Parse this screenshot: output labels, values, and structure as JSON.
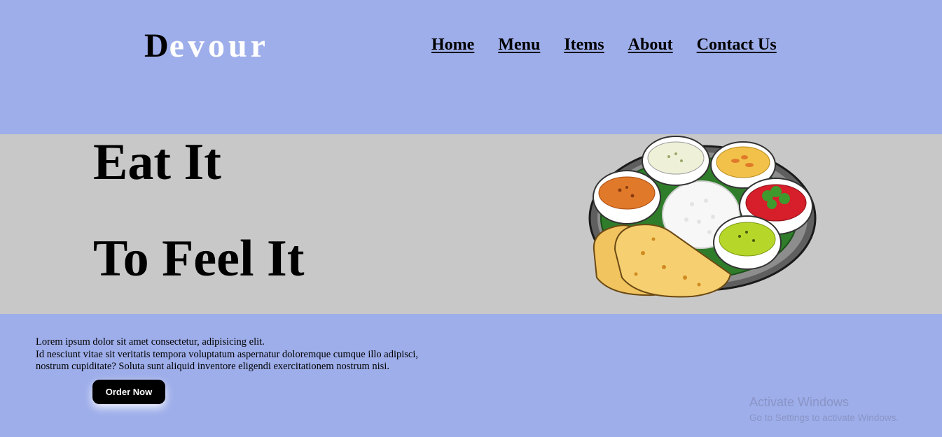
{
  "brand": {
    "first_letter": "D",
    "rest": "evour"
  },
  "nav": {
    "items": [
      {
        "label": "Home"
      },
      {
        "label": "Menu"
      },
      {
        "label": "Items"
      },
      {
        "label": "About"
      },
      {
        "label": "Contact Us"
      }
    ]
  },
  "hero": {
    "line1": "Eat It",
    "line2": "To Feel It",
    "image_icon": "thali-plate-icon"
  },
  "description": {
    "lines": [
      "Lorem ipsum dolor sit amet consectetur, adipisicing elit.",
      "Id nesciunt vitae sit veritatis tempora voluptatum aspernatur doloremque cumque illo adipisci,",
      "nostrum cupiditate? Soluta sunt aliquid inventore eligendi exercitationem nostrum nisi."
    ]
  },
  "cta": {
    "label": "Order Now"
  },
  "watermark": {
    "title": "Activate Windows",
    "subtitle": "Go to Settings to activate Windows."
  },
  "colors": {
    "page_background": "#9eaeea",
    "hero_background": "#c8c8c8",
    "text": "#000000",
    "logo_accent": "#ffffff",
    "button_background": "#000000",
    "button_text": "#ffffff"
  }
}
